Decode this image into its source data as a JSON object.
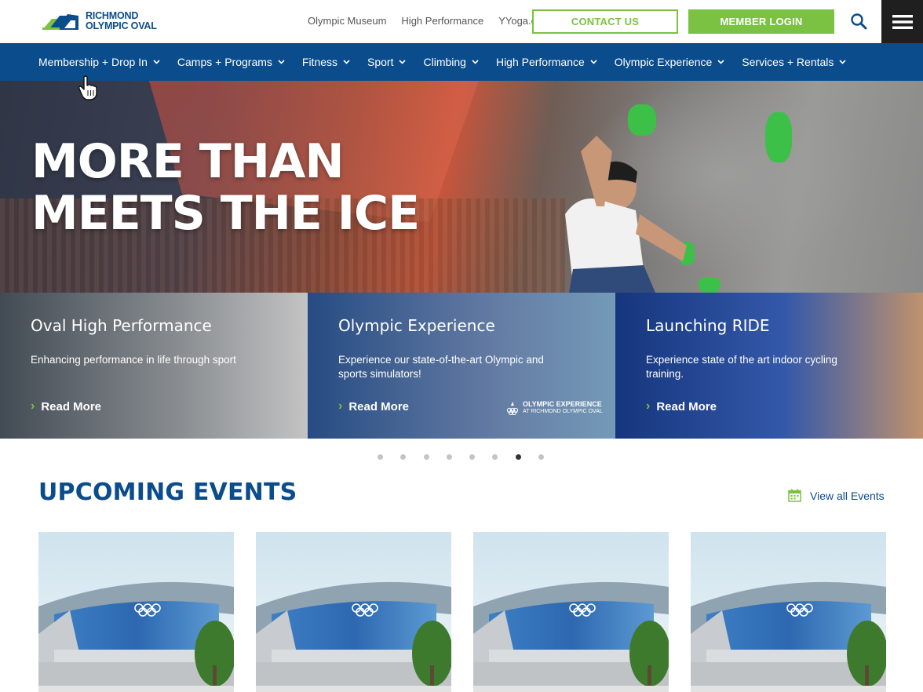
{
  "site": {
    "logo_line1": "RICHMOND",
    "logo_line2": "OLYMPIC OVAL"
  },
  "utility_nav": {
    "links": [
      "Olympic Museum",
      "High Performance",
      "YYoga.ca"
    ],
    "contact_label": "CONTACT US",
    "login_label": "MEMBER LOGIN",
    "search_icon": "search-icon",
    "menu_icon": "hamburger-menu-icon"
  },
  "main_nav": {
    "items": [
      "Membership + Drop In",
      "Camps + Programs",
      "Fitness",
      "Sport",
      "Climbing",
      "High Performance",
      "Olympic Experience",
      "Services + Rentals"
    ]
  },
  "hero": {
    "title_line1": "MORE THAN",
    "title_line2": "MEETS THE ICE"
  },
  "cards": [
    {
      "title": "Oval High Performance",
      "description": "Enhancing performance in life through sport",
      "link": "Read More"
    },
    {
      "title": "Olympic Experience",
      "description": "Experience our state-of-the-art Olympic and sports simulators!",
      "link": "Read More",
      "badge_line1": "OLYMPIC EXPERIENCE",
      "badge_line2": "AT RICHMOND OLYMPIC OVAL"
    },
    {
      "title": "Launching RIDE",
      "description": "Experience state of the art indoor cycling training.",
      "link": "Read More"
    }
  ],
  "carousel": {
    "dot_count": 8,
    "active_index": 6
  },
  "events": {
    "title": "UPCOMING EVENTS",
    "view_all_label": "View all Events",
    "view_all_icon": "calendar-icon"
  },
  "colors": {
    "brand_blue": "#0b4c8c",
    "accent_green": "#7bc142",
    "menu_dark": "#1f1f1f"
  }
}
